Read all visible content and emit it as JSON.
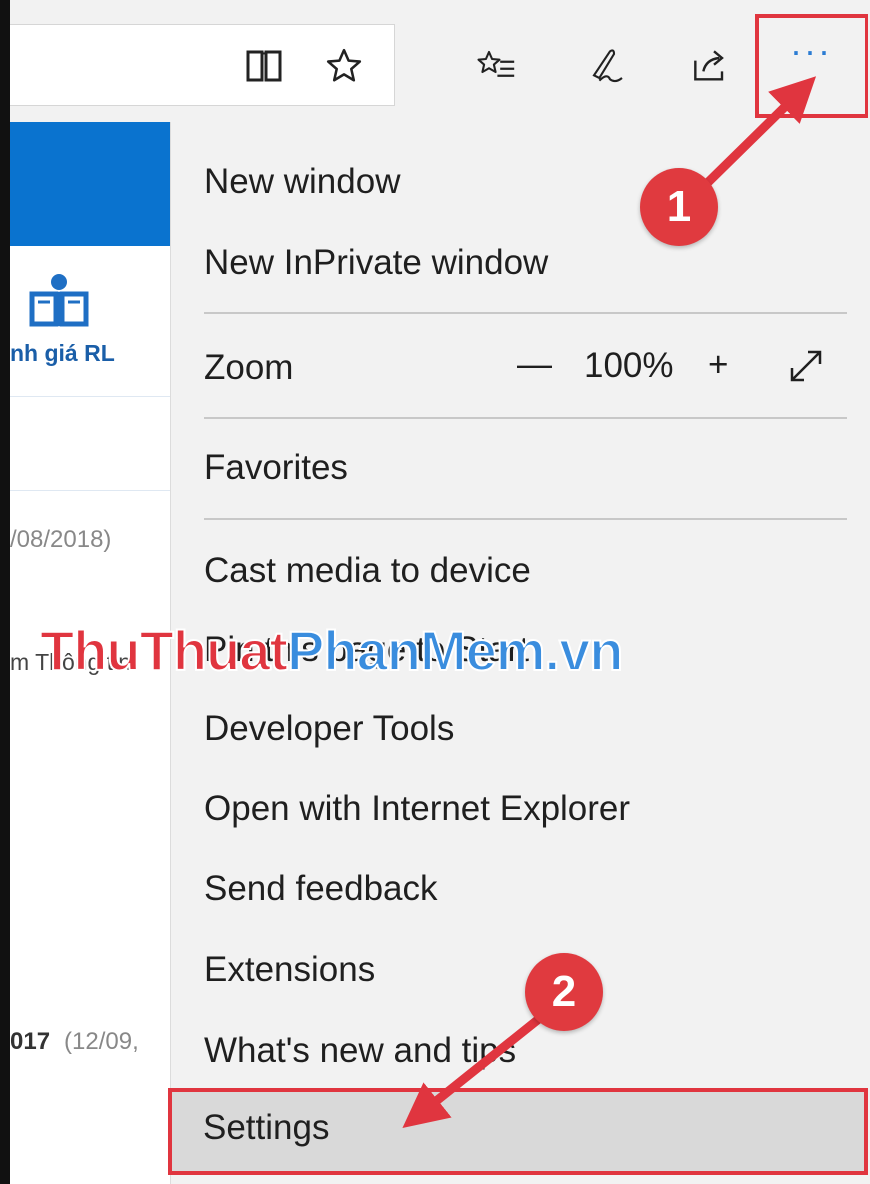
{
  "toolbar": {
    "icons": [
      "reading-view-icon",
      "favorite-star-icon",
      "favorites-hub-icon",
      "web-note-icon",
      "share-icon",
      "more-actions-icon"
    ],
    "more_label": "···"
  },
  "page_behind": {
    "rl_text": "nh giá RL",
    "date_text": "/08/2018)",
    "thong_text": "m Thông tin",
    "bottom_bold": "017",
    "bottom_date": "(12/09,"
  },
  "menu": {
    "new_window": "New window",
    "new_inprivate": "New InPrivate window",
    "zoom_label": "Zoom",
    "zoom_minus": "—",
    "zoom_value": "100%",
    "zoom_plus": "+",
    "favorites": "Favorites",
    "cast": "Cast media to device",
    "pin": "Pin this page to Start",
    "devtools": "Developer Tools",
    "open_ie": "Open with Internet Explorer",
    "feedback": "Send feedback",
    "extensions": "Extensions",
    "whats_new": "What's new and tips",
    "settings": "Settings"
  },
  "watermark": {
    "part1": "ThuThuat",
    "part2": "PhanMem",
    "part3": ".vn"
  },
  "annotations": {
    "badge1": "1",
    "badge2": "2"
  },
  "colors": {
    "accent_red": "#e0353f",
    "edge_blue": "#0a73cf",
    "dots_blue": "#2b7cd3"
  }
}
